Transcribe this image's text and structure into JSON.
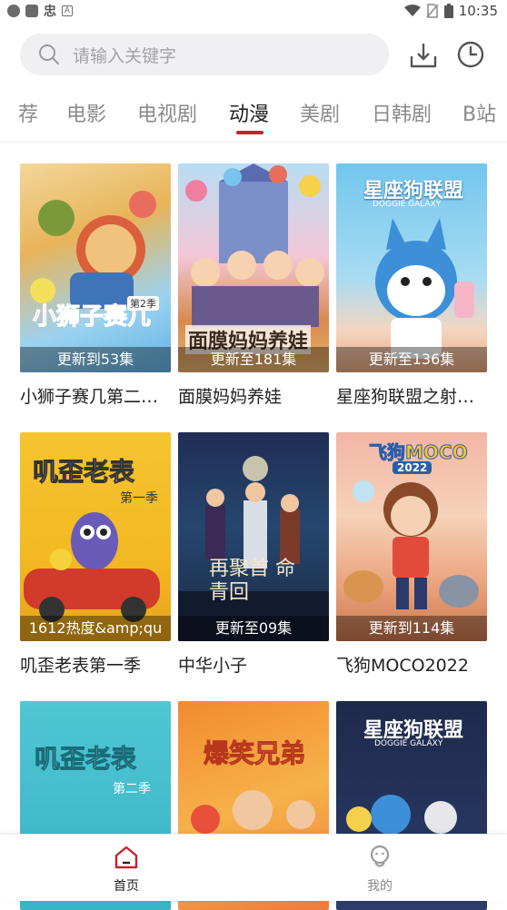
{
  "status_bar": {
    "left_glyph": "忠",
    "time": "10:35"
  },
  "search": {
    "placeholder": "请输入关键字"
  },
  "tabs": [
    {
      "label": "荐"
    },
    {
      "label": "电影"
    },
    {
      "label": "电视剧"
    },
    {
      "label": "动漫"
    },
    {
      "label": "美剧"
    },
    {
      "label": "日韩剧"
    },
    {
      "label": "B站"
    }
  ],
  "active_tab": "动漫",
  "cards": [
    {
      "title": "小狮子赛几第二…",
      "badge": "更新到53集",
      "poster_text": "小狮子赛几",
      "poster_sub": "第2季"
    },
    {
      "title": "面膜妈妈养娃",
      "badge": "更新至181集",
      "poster_text": "面膜妈妈养娃",
      "poster_sub": ""
    },
    {
      "title": "星座狗联盟之射…",
      "badge": "更新至136集",
      "poster_text": "星座狗联盟",
      "poster_sub": "DOGGIE GALAXY"
    },
    {
      "title": "叽歪老表第一季",
      "badge": "1612热度&amp;qu",
      "poster_text": "叽歪老表",
      "poster_sub": "第一季"
    },
    {
      "title": "中华小子",
      "badge": "更新至09集",
      "poster_text": "再聚首 命青回",
      "poster_sub": ""
    },
    {
      "title": "飞狗MOCO2022",
      "badge": "更新到114集",
      "poster_text": "飞狗MOCO",
      "poster_sub": "2022"
    },
    {
      "title": "",
      "badge": "",
      "poster_text": "叽歪老表",
      "poster_sub": "第二季"
    },
    {
      "title": "",
      "badge": "",
      "poster_text": "爆笑兄弟",
      "poster_sub": ""
    },
    {
      "title": "",
      "badge": "",
      "poster_text": "星座狗联盟",
      "poster_sub": "DOGGIE GALAXY"
    }
  ],
  "bottom_nav": [
    {
      "label": "首页",
      "active": true
    },
    {
      "label": "我的",
      "active": false
    }
  ],
  "colors": {
    "accent": "#c8232c",
    "active_tab": "#222222",
    "inactive": "#8a8a8a"
  }
}
